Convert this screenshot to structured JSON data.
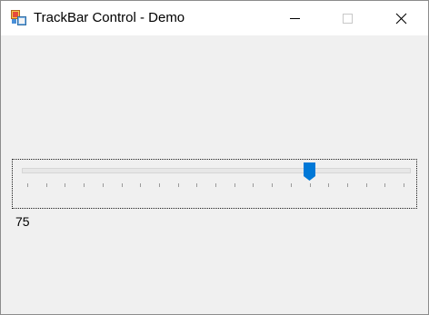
{
  "window": {
    "title": "TrackBar Control - Demo"
  },
  "titlebar": {
    "app_icon": "winforms-app-icon",
    "buttons": {
      "minimize_icon": "minimize-icon",
      "maximize_icon": "maximize-icon",
      "close_icon": "close-icon"
    }
  },
  "trackbar": {
    "minimum": 0,
    "maximum": 100,
    "value": 75,
    "tick_frequency": 5,
    "accent_color": "#0078d7"
  },
  "value_label": {
    "text": "75"
  }
}
